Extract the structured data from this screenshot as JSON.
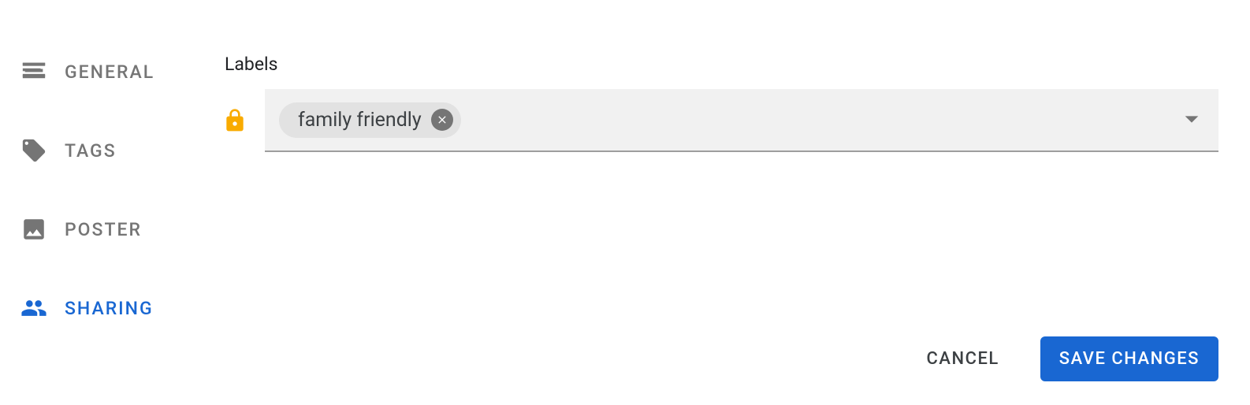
{
  "sidebar": {
    "items": [
      {
        "label": "General"
      },
      {
        "label": "Tags"
      },
      {
        "label": "Poster"
      },
      {
        "label": "Sharing"
      }
    ]
  },
  "main": {
    "labels_field_label": "Labels",
    "chips": [
      {
        "text": "family friendly"
      }
    ]
  },
  "footer": {
    "cancel_label": "Cancel",
    "save_label": "Save Changes"
  }
}
